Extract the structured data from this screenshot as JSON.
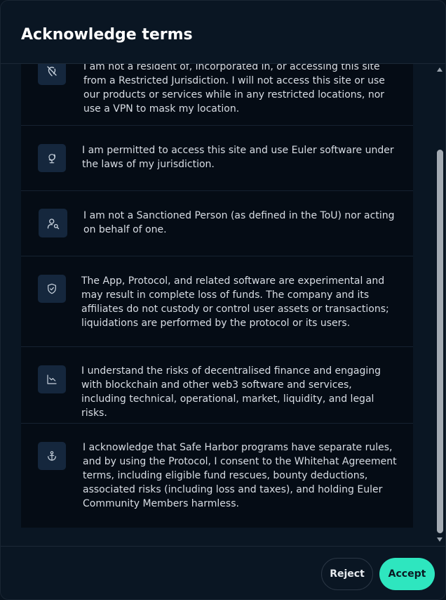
{
  "dialog": {
    "title": "Acknowledge terms"
  },
  "terms": [
    {
      "icon": "location-off-icon",
      "text": "I am not a resident of, incorporated in, or accessing this site from a Restricted Jurisdiction. I will not access this site or use our products or services while in any restricted locations, nor use a VPN to mask my location."
    },
    {
      "icon": "globe-icon",
      "text": "I am permitted to access this site and use Euler software under the laws of my jurisdiction."
    },
    {
      "icon": "user-search-icon",
      "text": "I am not a Sanctioned Person (as defined in the ToU) nor acting on behalf of one."
    },
    {
      "icon": "shield-check-icon",
      "text": "The App, Protocol, and related software are experimental and may result in complete loss of funds. The company and its affiliates do not custody or control user assets or transactions; liquidations are performed by the protocol or its users."
    },
    {
      "icon": "chart-down-icon",
      "text": "I understand the risks of decentralised finance and engaging with blockchain and other web3 software and services, including technical, operational, market, liquidity, and legal risks."
    },
    {
      "icon": "anchor-icon",
      "text": "I acknowledge that Safe Harbor programs have separate rules, and by using the Protocol, I consent to the Whitehat Agreement terms, including eligible fund rescues, bounty deductions, associated risks (including loss and taxes), and holding Euler Community Members harmless."
    }
  ],
  "footer": {
    "reject_label": "Reject",
    "accept_label": "Accept"
  },
  "colors": {
    "accent": "#2ee6bf",
    "background": "#0a1623",
    "list_background": "#050c15",
    "icon_tile": "#15273d"
  }
}
